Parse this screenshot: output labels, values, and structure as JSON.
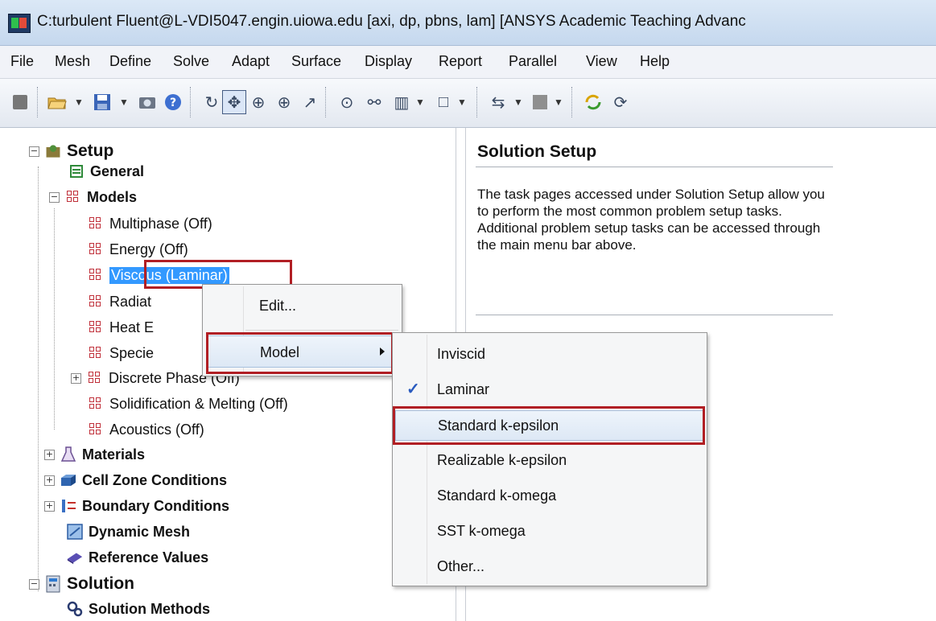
{
  "window": {
    "title": "C:turbulent Fluent@L-VDI5047.engin.uiowa.edu  [axi, dp, pbns, lam] [ANSYS Academic Teaching Advanc"
  },
  "menubar": {
    "items": [
      "File",
      "Mesh",
      "Define",
      "Solve",
      "Adapt",
      "Surface",
      "Display",
      "Report",
      "Parallel",
      "View",
      "Help"
    ]
  },
  "toolbar": {
    "icons": [
      "mesh-display-icon",
      "open-folder-icon",
      "save-icon",
      "camera-icon",
      "help-icon",
      "rotate-icon",
      "pan-icon",
      "zoom-icon",
      "zoom-in-icon",
      "probe-icon",
      "zoom-to-fit-icon",
      "views-icon",
      "layout-icon",
      "window-icon",
      "split-icon",
      "color-icon",
      "refresh-icon",
      "reset-icon"
    ]
  },
  "tree": {
    "setup": "Setup",
    "general": "General",
    "models": "Models",
    "multiphase": "Multiphase (Off)",
    "energy": "Energy (Off)",
    "viscous": "Viscous (Laminar)",
    "radiation": "Radiat",
    "heat_exchanger": "Heat E",
    "species": "Specie",
    "discrete_phase": "Discrete Phase (Off)",
    "solidification": "Solidification & Melting (Off)",
    "acoustics": "Acoustics (Off)",
    "materials": "Materials",
    "cell_zone": "Cell Zone Conditions",
    "boundary": "Boundary Conditions",
    "dynamic_mesh": "Dynamic Mesh",
    "reference_values": "Reference Values",
    "solution": "Solution",
    "solution_methods": "Solution Methods"
  },
  "panel": {
    "heading": "Solution Setup",
    "description": "The task pages accessed under Solution Setup allow you to perform the most common problem setup tasks. Additional problem setup tasks can be accessed through the main menu bar above."
  },
  "context_menu": {
    "edit": "Edit...",
    "model": "Model"
  },
  "submenu": {
    "inviscid": "Inviscid",
    "laminar": "Laminar",
    "check": "✓",
    "std_keps": "Standard k-epsilon",
    "real_keps": "Realizable k-epsilon",
    "std_komega": "Standard k-omega",
    "sst_komega": "SST k-omega",
    "other": "Other..."
  },
  "colors": {
    "highlight_border": "#b11f24",
    "selection": "#3399ff"
  }
}
